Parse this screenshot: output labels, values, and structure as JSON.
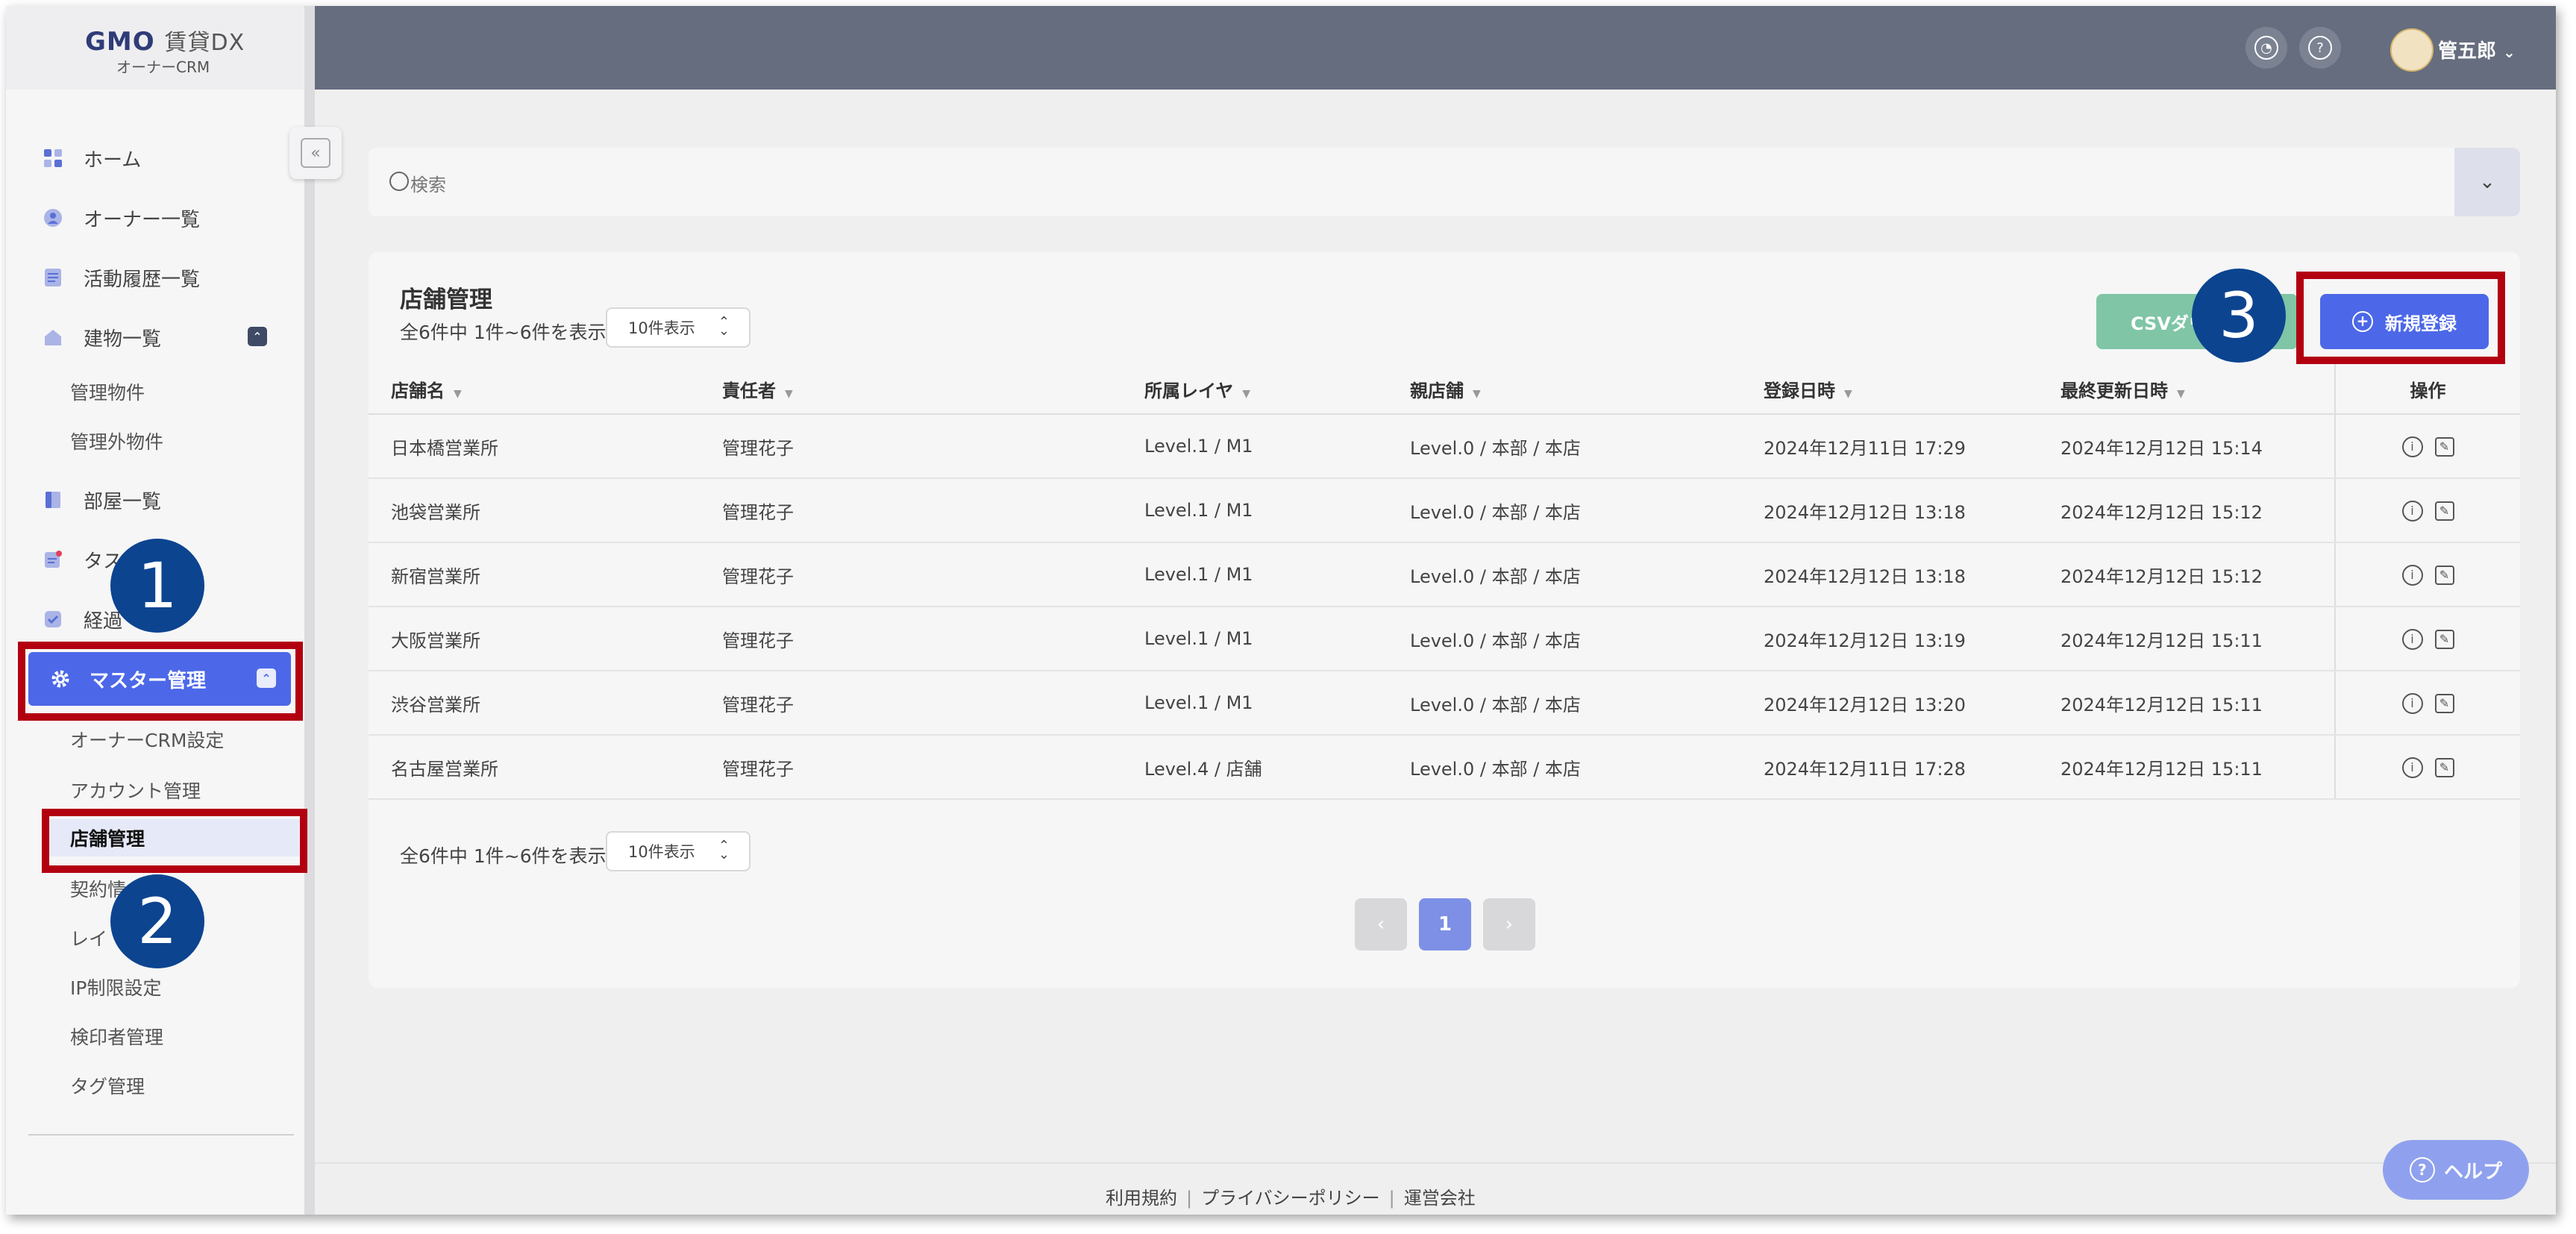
{
  "logo": {
    "brand": "GMO",
    "product": "賃貸DX",
    "sub": "オーナーCRM"
  },
  "sidebar": {
    "items": [
      {
        "label": "ホーム"
      },
      {
        "label": "オーナー一覧"
      },
      {
        "label": "活動履歴一覧"
      },
      {
        "label": "建物一覧"
      },
      {
        "label": "部屋一覧"
      },
      {
        "label": "タス"
      },
      {
        "label": "経過"
      },
      {
        "label": "マスター管理"
      }
    ],
    "building_sub": [
      "管理物件",
      "管理外物件"
    ],
    "master_sub": [
      "オーナーCRM設定",
      "アカウント管理",
      "店舗管理",
      "契約情",
      "レイ",
      "IP制限設定",
      "検印者管理",
      "タグ管理"
    ]
  },
  "topbar": {
    "user": "管五郎",
    "notify_icon": "bell-icon",
    "help_icon": "question-icon"
  },
  "search": {
    "placeholder": "検索"
  },
  "card": {
    "title": "店舗管理",
    "count": "全6件中 1件~6件を表示",
    "per_page": "10件表示",
    "csv_label": "CSVダウ",
    "new_label": "新規登録"
  },
  "table": {
    "headers": [
      "店舗名",
      "責任者",
      "所属レイヤ",
      "親店舗",
      "登録日時",
      "最終更新日時",
      "操作"
    ],
    "rows": [
      [
        "日本橋営業所",
        "管理花子",
        "Level.1 / M1",
        "Level.0 / 本部 / 本店",
        "2024年12月11日 17:29",
        "2024年12月12日 15:14"
      ],
      [
        "池袋営業所",
        "管理花子",
        "Level.1 / M1",
        "Level.0 / 本部 / 本店",
        "2024年12月12日 13:18",
        "2024年12月12日 15:12"
      ],
      [
        "新宿営業所",
        "管理花子",
        "Level.1 / M1",
        "Level.0 / 本部 / 本店",
        "2024年12月12日 13:18",
        "2024年12月12日 15:12"
      ],
      [
        "大阪営業所",
        "管理花子",
        "Level.1 / M1",
        "Level.0 / 本部 / 本店",
        "2024年12月12日 13:19",
        "2024年12月12日 15:11"
      ],
      [
        "渋谷営業所",
        "管理花子",
        "Level.1 / M1",
        "Level.0 / 本部 / 本店",
        "2024年12月12日 13:20",
        "2024年12月12日 15:11"
      ],
      [
        "名古屋営業所",
        "管理花子",
        "Level.4 / 店舗",
        "Level.0 / 本部 / 本店",
        "2024年12月11日 17:28",
        "2024年12月12日 15:11"
      ]
    ]
  },
  "pagination": {
    "prev": "‹",
    "current": "1",
    "next": "›"
  },
  "footer": {
    "terms": "利用規約",
    "privacy": "プライバシーポリシー",
    "company": "運営会社"
  },
  "help": {
    "label": "ヘルプ"
  },
  "annotations": {
    "step1": "1",
    "step2": "2",
    "step3": "3"
  },
  "colors": {
    "accent": "#4c68e8",
    "highlight": "#b30010",
    "badge": "#0c4490",
    "csv": "#7fc5a6"
  }
}
